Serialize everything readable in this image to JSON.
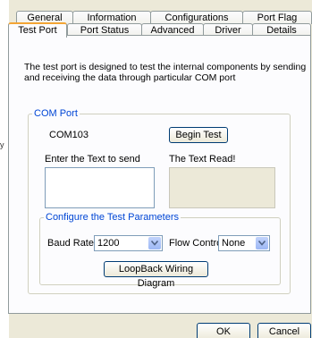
{
  "tabs_row1": [
    "General",
    "Information",
    "Configurations",
    "Port Flag"
  ],
  "tabs_row2": [
    "Test Port",
    "Port Status",
    "Advanced",
    "Driver",
    "Details"
  ],
  "active_tab": "Test Port",
  "description": [
    "The test port is designed to test the internal components by sending",
    "and receiving the data through particular COM port"
  ],
  "com_port": {
    "legend": "COM Port",
    "port_name": "COM103",
    "begin_test_label": "Begin Test",
    "send_label": "Enter the Text to send",
    "read_label": "The Text Read!",
    "send_value": "",
    "read_value": ""
  },
  "test_params": {
    "legend": "Configure the Test Parameters",
    "baud_label": "Baud Rate",
    "baud_value": "1200",
    "flow_label": "Flow Control",
    "flow_value": "None",
    "loopback_label": "LoopBack Wiring Diagram"
  },
  "footer": {
    "ok_label": "OK",
    "cancel_label": "Cancel"
  },
  "colors": {
    "dialog_bg": "#ece9d8",
    "group_legend": "#0046d5",
    "active_tab_accent": "#f3a535"
  },
  "icons": {
    "dropdown": "chevron-down-icon"
  }
}
